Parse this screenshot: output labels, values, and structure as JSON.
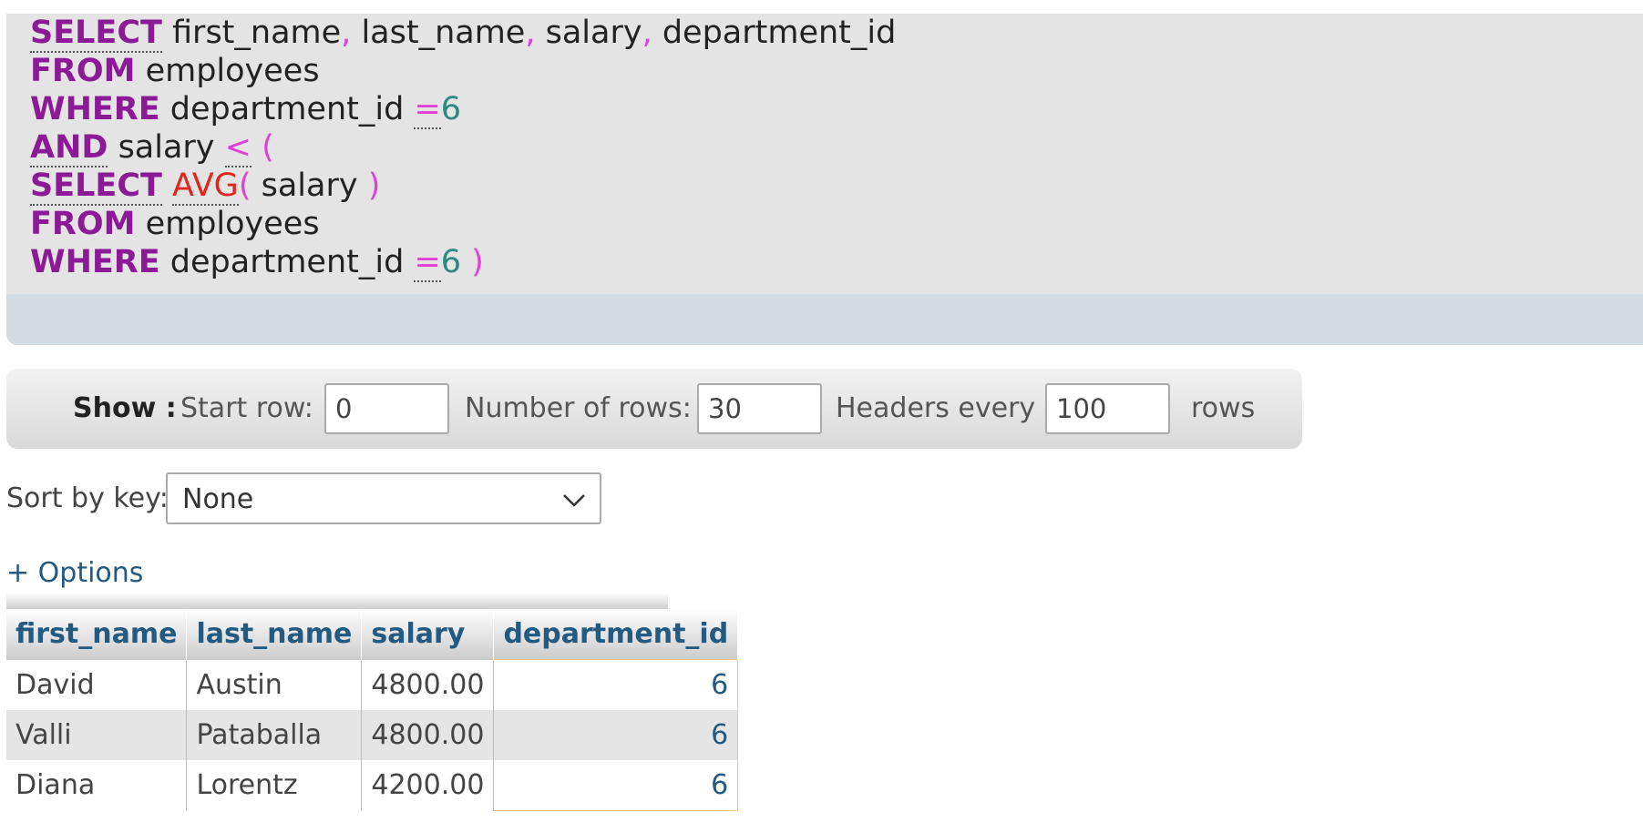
{
  "sql": {
    "lines": [
      [
        {
          "t": "SELECT",
          "c": "kw dot"
        },
        {
          "t": " first_name",
          "c": ""
        },
        {
          "t": ",",
          "c": "op"
        },
        {
          "t": " last_name",
          "c": ""
        },
        {
          "t": ",",
          "c": "op"
        },
        {
          "t": " salary",
          "c": ""
        },
        {
          "t": ",",
          "c": "op"
        },
        {
          "t": " department_id",
          "c": ""
        }
      ],
      [
        {
          "t": "FROM",
          "c": "kw"
        },
        {
          "t": " employees",
          "c": ""
        }
      ],
      [
        {
          "t": "WHERE",
          "c": "kw"
        },
        {
          "t": " department_id ",
          "c": ""
        },
        {
          "t": "=",
          "c": "op dotop"
        },
        {
          "t": "6",
          "c": "num"
        }
      ],
      [
        {
          "t": "AND",
          "c": "kw dot"
        },
        {
          "t": " salary ",
          "c": ""
        },
        {
          "t": "<",
          "c": "op dotop"
        },
        {
          "t": " (",
          "c": "op"
        }
      ],
      [
        {
          "t": "SELECT",
          "c": "kw dot"
        },
        {
          "t": " ",
          "c": ""
        },
        {
          "t": "AVG",
          "c": "fn"
        },
        {
          "t": "(",
          "c": "op"
        },
        {
          "t": " salary ",
          "c": ""
        },
        {
          "t": ")",
          "c": "op"
        }
      ],
      [
        {
          "t": "FROM",
          "c": "kw"
        },
        {
          "t": " employees",
          "c": ""
        }
      ],
      [
        {
          "t": "WHERE",
          "c": "kw"
        },
        {
          "t": " department_id ",
          "c": ""
        },
        {
          "t": "=",
          "c": "op dotop"
        },
        {
          "t": "6",
          "c": "num"
        },
        {
          "t": " )",
          "c": "op"
        }
      ]
    ]
  },
  "show": {
    "title": "Show :",
    "start_row_label": "Start row:",
    "start_row_value": "0",
    "num_rows_label": "Number of rows:",
    "num_rows_value": "30",
    "headers_every_label": "Headers every",
    "headers_every_value": "100",
    "rows_label": "rows"
  },
  "sort": {
    "label": "Sort by key:",
    "selected": "None"
  },
  "options_link": "+ Options",
  "table": {
    "columns": [
      "first_name",
      "last_name",
      "salary",
      "department_id"
    ],
    "rows": [
      [
        "David",
        "Austin",
        "4800.00",
        "6"
      ],
      [
        "Valli",
        "Pataballa",
        "4800.00",
        "6"
      ],
      [
        "Diana",
        "Lorentz",
        "4200.00",
        "6"
      ]
    ]
  },
  "colors": {
    "keyword": "#8c1a96",
    "operator": "#e040d8",
    "number": "#2b8a7f",
    "function": "#e0261e",
    "link": "#235a81"
  }
}
